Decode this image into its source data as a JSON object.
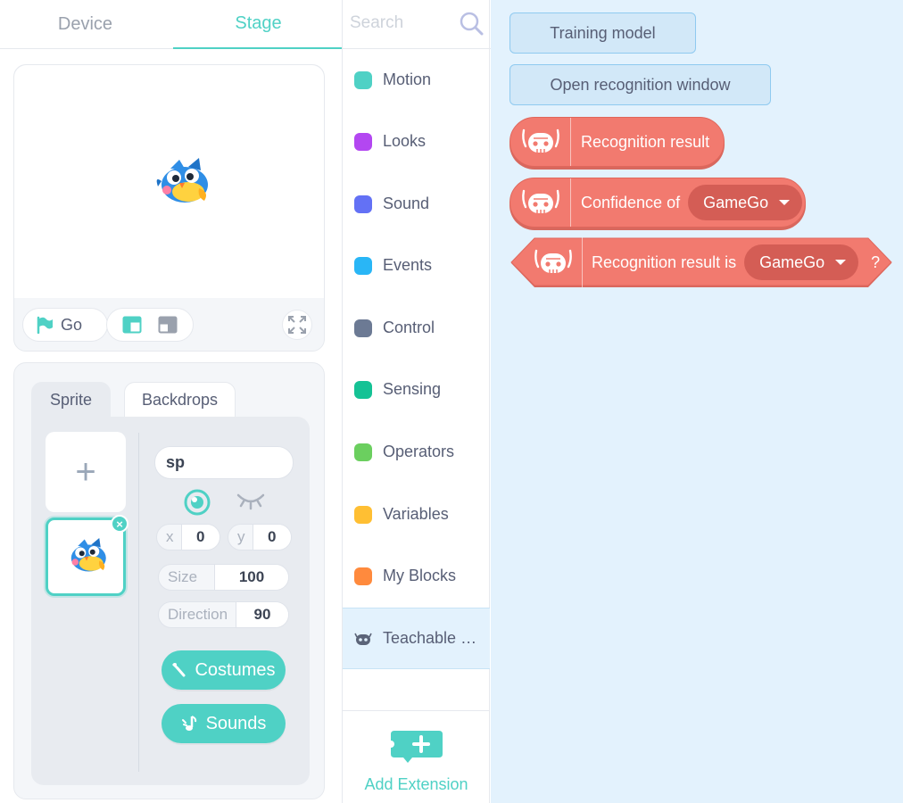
{
  "left_tabs": {
    "device": "Device",
    "stage": "Stage"
  },
  "stage": {
    "go_label": "Go"
  },
  "sprite_panel": {
    "tab_sprite": "Sprite",
    "tab_backdrops": "Backdrops",
    "add_symbol": "+",
    "sprite_name": "sp",
    "x_label": "x",
    "x_value": "0",
    "y_label": "y",
    "y_value": "0",
    "size_label": "Size",
    "size_value": "100",
    "direction_label": "Direction",
    "direction_value": "90",
    "costumes_label": "Costumes",
    "sounds_label": "Sounds"
  },
  "search": {
    "placeholder": "Search"
  },
  "categories": [
    {
      "label": "Motion",
      "color": "#4fd1c5"
    },
    {
      "label": "Looks",
      "color": "#b347f1"
    },
    {
      "label": "Sound",
      "color": "#6371f5"
    },
    {
      "label": "Events",
      "color": "#29b6f6"
    },
    {
      "label": "Control",
      "color": "#6c7a94"
    },
    {
      "label": "Sensing",
      "color": "#15c295"
    },
    {
      "label": "Operators",
      "color": "#6bcf5f"
    },
    {
      "label": "Variables",
      "color": "#ffbf33"
    },
    {
      "label": "My Blocks",
      "color": "#ff8a3d"
    },
    {
      "label": "Teachable Machine",
      "icon": "robot-icon",
      "active": true
    }
  ],
  "add_extension": {
    "label": "Add Extension"
  },
  "blocks": {
    "training_model": "Training model",
    "open_recognition_window": "Open recognition window",
    "recognition_result": "Recognition result",
    "confidence_of": "Confidence of",
    "confidence_option": "GameGo",
    "recognition_result_is": "Recognition result is",
    "result_is_option": "GameGo",
    "question_mark": "?"
  },
  "colors": {
    "accent_teal": "#4fd1c5",
    "block_red": "#f27a6f",
    "workspace_bg": "#e3f2fd"
  }
}
